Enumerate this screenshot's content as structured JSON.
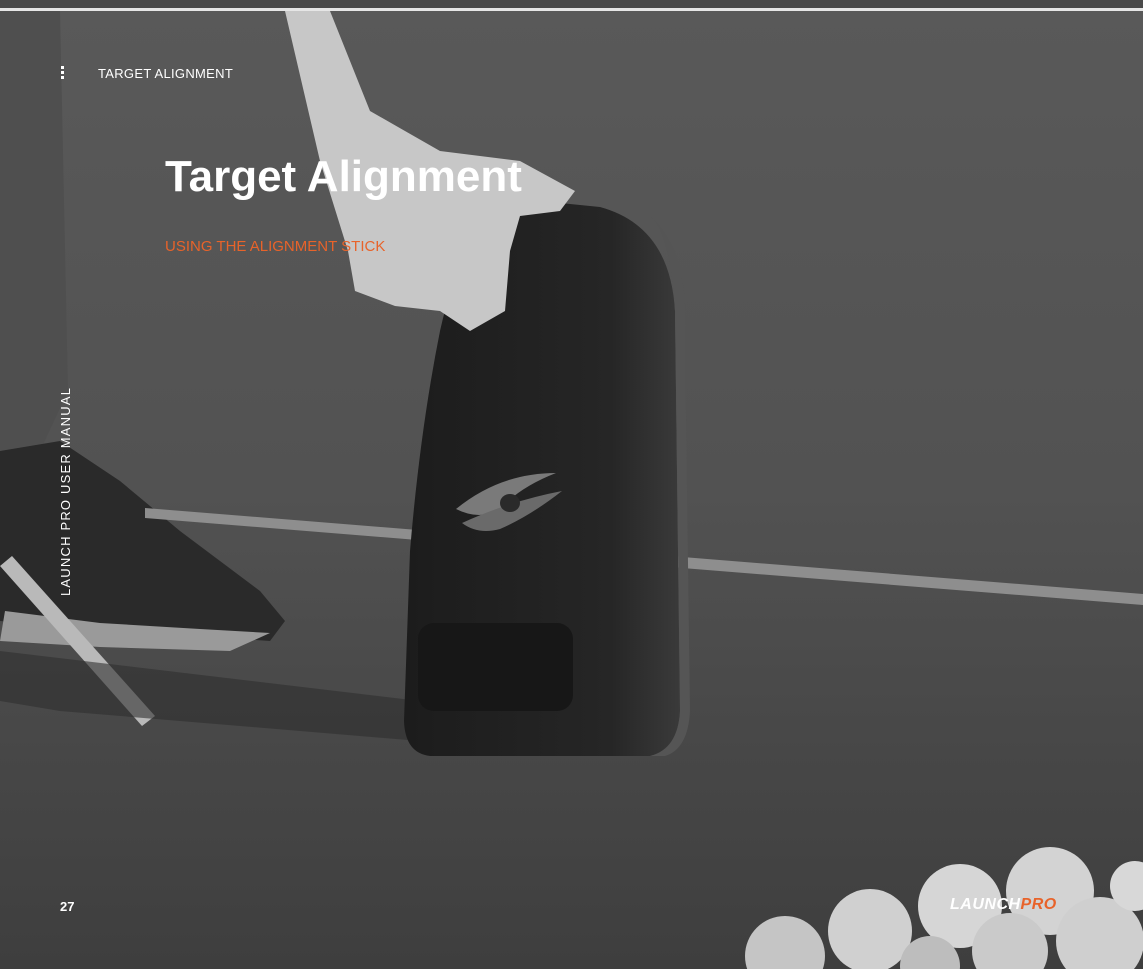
{
  "header": {
    "menu_icon": "vertical-dots-icon",
    "breadcrumb": "TARGET ALIGNMENT"
  },
  "main": {
    "title": "Target Alignment",
    "subtitle": "USING THE ALIGNMENT STICK"
  },
  "sidebar": {
    "label": "LAUNCH PRO USER MANUAL"
  },
  "footer": {
    "page_number": "27",
    "brand_part1": "LAUNCH",
    "brand_part2": "PRO"
  },
  "colors": {
    "accent": "#e8632a",
    "text": "#ffffff",
    "overlay": "#4a4a4a"
  }
}
